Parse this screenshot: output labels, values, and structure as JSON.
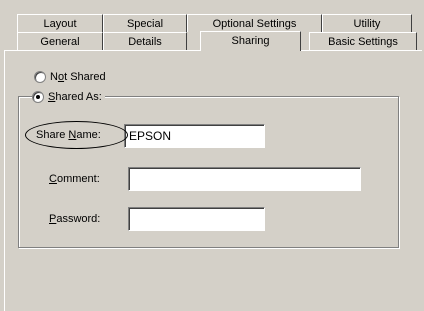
{
  "tabs_back_row": [
    {
      "name": "tab-layout",
      "label": "Layout"
    },
    {
      "name": "tab-special",
      "label": "Special"
    },
    {
      "name": "tab-optional-settings",
      "label": "Optional Settings"
    },
    {
      "name": "tab-utility",
      "label": "Utility"
    }
  ],
  "tabs_front_row": [
    {
      "name": "tab-general",
      "label": "General"
    },
    {
      "name": "tab-details",
      "label": "Details"
    },
    {
      "name": "tab-sharing",
      "label": "Sharing",
      "selected": true
    },
    {
      "name": "tab-basic-settings",
      "label": "Basic Settings"
    }
  ],
  "sharing": {
    "not_shared": {
      "prefix": "N",
      "accel": "o",
      "suffix": "t Shared",
      "checked": false
    },
    "shared_as": {
      "prefix": "",
      "accel": "S",
      "suffix": "hared As:",
      "checked": true
    },
    "share_name": {
      "prefix": "Share ",
      "accel": "N",
      "suffix": "ame:",
      "value": "EPSON"
    },
    "comment": {
      "prefix": "",
      "accel": "C",
      "suffix": "omment:",
      "value": ""
    },
    "password": {
      "prefix": "",
      "accel": "P",
      "suffix": "assword:",
      "value": ""
    }
  },
  "colors": {
    "dialog_face": "#d4d0c8",
    "highlight": "#ffffff",
    "shadow": "#808080",
    "annotation": "#000000"
  }
}
